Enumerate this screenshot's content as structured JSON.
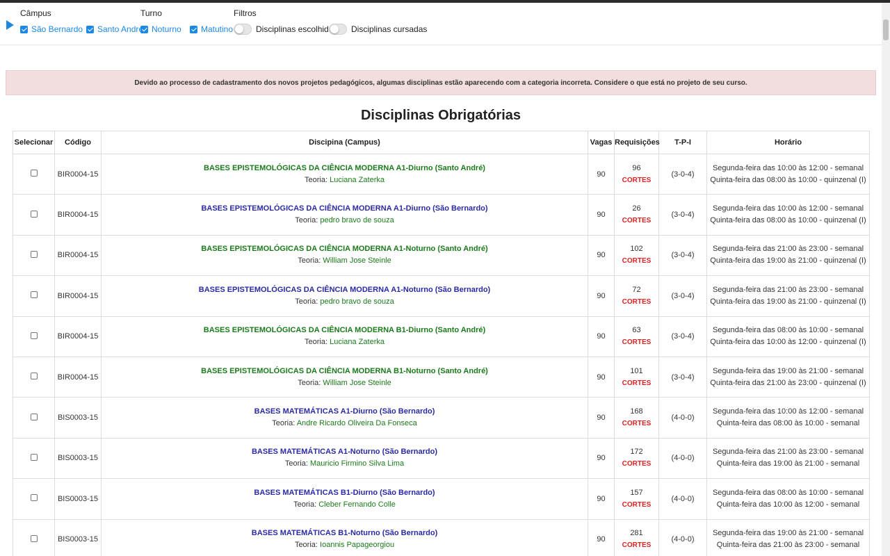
{
  "filters": {
    "campus_label": "Câmpus",
    "turno_label": "Turno",
    "filtros_label": "Filtros",
    "campus_options": [
      "São Bernardo",
      "Santo André"
    ],
    "turno_options": [
      "Noturno",
      "Matutino"
    ],
    "toggle_chosen": "Disciplinas escolhidas",
    "toggle_taken": "Disciplinas cursadas"
  },
  "notice": "Devido ao processo de cadastramento dos novos projetos pedagógicos, algumas disciplinas estão aparecendo com a categoria incorreta. Considere o que está no projeto de seu curso.",
  "section_title": "Disciplinas Obrigatórias",
  "table": {
    "headers": {
      "select": "Selecionar",
      "code": "Código",
      "discipline": "Discipina (Campus)",
      "vagas": "Vagas",
      "req": "Requisições",
      "tpi": "T-P-I",
      "hor": "Horário"
    },
    "teacher_prefix": "Teoria:",
    "cortes_label": "CORTES",
    "rows": [
      {
        "code": "BIR0004-15",
        "name": "BASES EPISTEMOLÓGICAS DA CIÊNCIA MODERNA A1-Diurno (Santo André)",
        "teacher": "Luciana Zaterka",
        "vagas": "90",
        "req": "96",
        "tpi": "(3-0-4)",
        "h1": "Segunda-feira das 10:00 às 12:00 - semanal",
        "h2": "Quinta-feira das 08:00 às 10:00 - quinzenal (I)"
      },
      {
        "code": "BIR0004-15",
        "name": "BASES EPISTEMOLÓGICAS DA CIÊNCIA MODERNA A1-Diurno (São Bernardo)",
        "teacher": "pedro bravo de souza",
        "vagas": "90",
        "req": "26",
        "tpi": "(3-0-4)",
        "h1": "Segunda-feira das 10:00 às 12:00 - semanal",
        "h2": "Quinta-feira das 08:00 às 10:00 - quinzenal (I)"
      },
      {
        "code": "BIR0004-15",
        "name": "BASES EPISTEMOLÓGICAS DA CIÊNCIA MODERNA A1-Noturno (Santo André)",
        "teacher": "William Jose Steinle",
        "vagas": "90",
        "req": "102",
        "tpi": "(3-0-4)",
        "h1": "Segunda-feira das 21:00 às 23:00 - semanal",
        "h2": "Quinta-feira das 19:00 às 21:00 - quinzenal (I)"
      },
      {
        "code": "BIR0004-15",
        "name": "BASES EPISTEMOLÓGICAS DA CIÊNCIA MODERNA A1-Noturno (São Bernardo)",
        "teacher": "pedro bravo de souza",
        "vagas": "90",
        "req": "72",
        "tpi": "(3-0-4)",
        "h1": "Segunda-feira das 21:00 às 23:00 - semanal",
        "h2": "Quinta-feira das 19:00 às 21:00 - quinzenal (I)"
      },
      {
        "code": "BIR0004-15",
        "name": "BASES EPISTEMOLÓGICAS DA CIÊNCIA MODERNA B1-Diurno (Santo André)",
        "teacher": "Luciana Zaterka",
        "vagas": "90",
        "req": "63",
        "tpi": "(3-0-4)",
        "h1": "Segunda-feira das 08:00 às 10:00 - semanal",
        "h2": "Quinta-feira das 10:00 às 12:00 - quinzenal (I)"
      },
      {
        "code": "BIR0004-15",
        "name": "BASES EPISTEMOLÓGICAS DA CIÊNCIA MODERNA B1-Noturno (Santo André)",
        "teacher": "William Jose Steinle",
        "vagas": "90",
        "req": "101",
        "tpi": "(3-0-4)",
        "h1": "Segunda-feira das 19:00 às 21:00 - semanal",
        "h2": "Quinta-feira das 21:00 às 23:00 - quinzenal (I)"
      },
      {
        "code": "BIS0003-15",
        "name": "BASES MATEMÁTICAS A1-Diurno (São Bernardo)",
        "teacher": "Andre Ricardo Oliveira Da Fonseca",
        "vagas": "90",
        "req": "168",
        "tpi": "(4-0-0)",
        "h1": "Segunda-feira das 10:00 às 12:00 - semanal",
        "h2": "Quinta-feira das 08:00 às 10:00 - semanal"
      },
      {
        "code": "BIS0003-15",
        "name": "BASES MATEMÁTICAS A1-Noturno (São Bernardo)",
        "teacher": "Mauricio Firmino Silva Lima",
        "vagas": "90",
        "req": "172",
        "tpi": "(4-0-0)",
        "h1": "Segunda-feira das 21:00 às 23:00 - semanal",
        "h2": "Quinta-feira das 19:00 às 21:00 - semanal"
      },
      {
        "code": "BIS0003-15",
        "name": "BASES MATEMÁTICAS B1-Diurno (São Bernardo)",
        "teacher": "Cleber Fernando Colle",
        "vagas": "90",
        "req": "157",
        "tpi": "(4-0-0)",
        "h1": "Segunda-feira das 08:00 às 10:00 - semanal",
        "h2": "Quinta-feira das 10:00 às 12:00 - semanal"
      },
      {
        "code": "BIS0003-15",
        "name": "BASES MATEMÁTICAS B1-Noturno (São Bernardo)",
        "teacher": "Ioannis Papageorgiou",
        "vagas": "90",
        "req": "281",
        "tpi": "(4-0-0)",
        "h1": "Segunda-feira das 19:00 às 21:00 - semanal",
        "h2": "Quinta-feira das 21:00 às 23:00 - semanal"
      }
    ]
  }
}
